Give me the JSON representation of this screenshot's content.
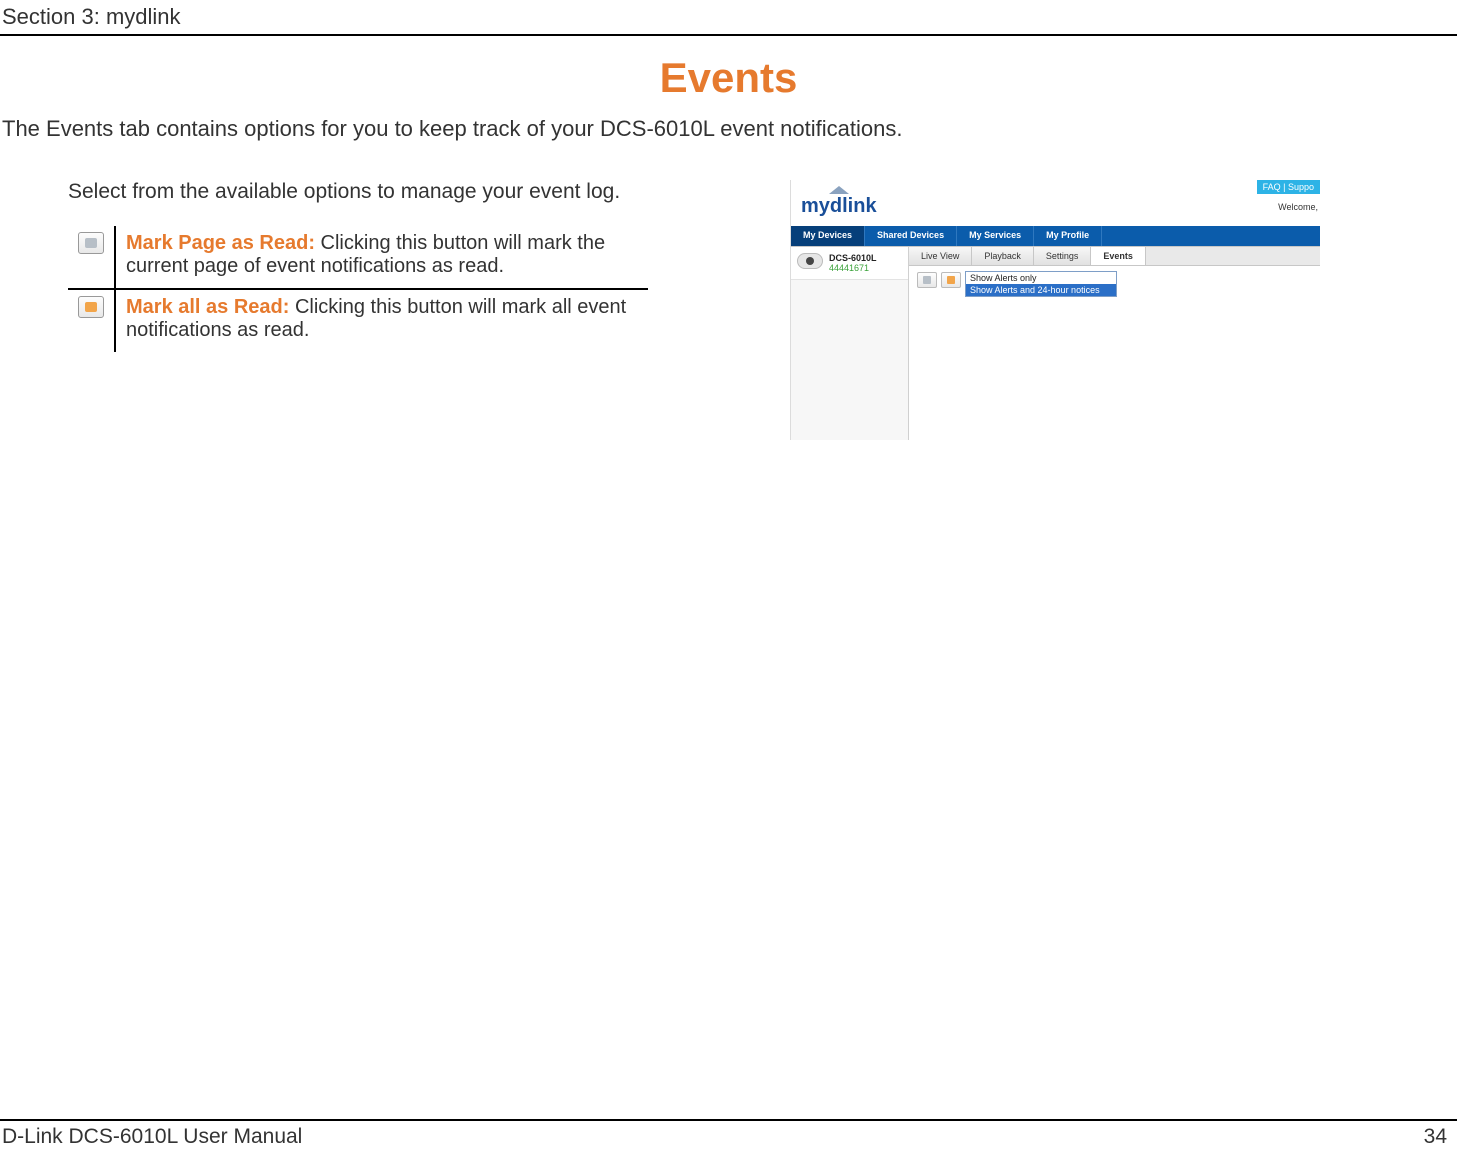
{
  "header": {
    "section": "Section 3: mydlink"
  },
  "title": "Events",
  "intro": "The Events tab contains options for you to keep track of your DCS-6010L event notifications.",
  "select_text": "Select from the available options to manage your event log.",
  "options": [
    {
      "label": "Mark Page as Read:",
      "desc": " Clicking this button will mark the current page of event notifications as read."
    },
    {
      "label": "Mark all as Read:",
      "desc": " Clicking this button will mark all event notifications as read."
    }
  ],
  "screenshot": {
    "logo_text": "mydlink",
    "faq": "FAQ  |  Suppo",
    "welcome": "Welcome,",
    "main_nav": [
      "My Devices",
      "Shared Devices",
      "My Services",
      "My Profile"
    ],
    "device": {
      "name": "DCS-6010L",
      "id": "44441671"
    },
    "sub_tabs": [
      "Live View",
      "Playback",
      "Settings",
      "Events"
    ],
    "dropdown_selected": "Show Alerts and 24-hour notices",
    "dropdown_options": [
      "Show Alerts only",
      "Show Alerts and 24-hour notices"
    ]
  },
  "footer": {
    "left": "D-Link DCS-6010L User Manual",
    "right": "34"
  }
}
